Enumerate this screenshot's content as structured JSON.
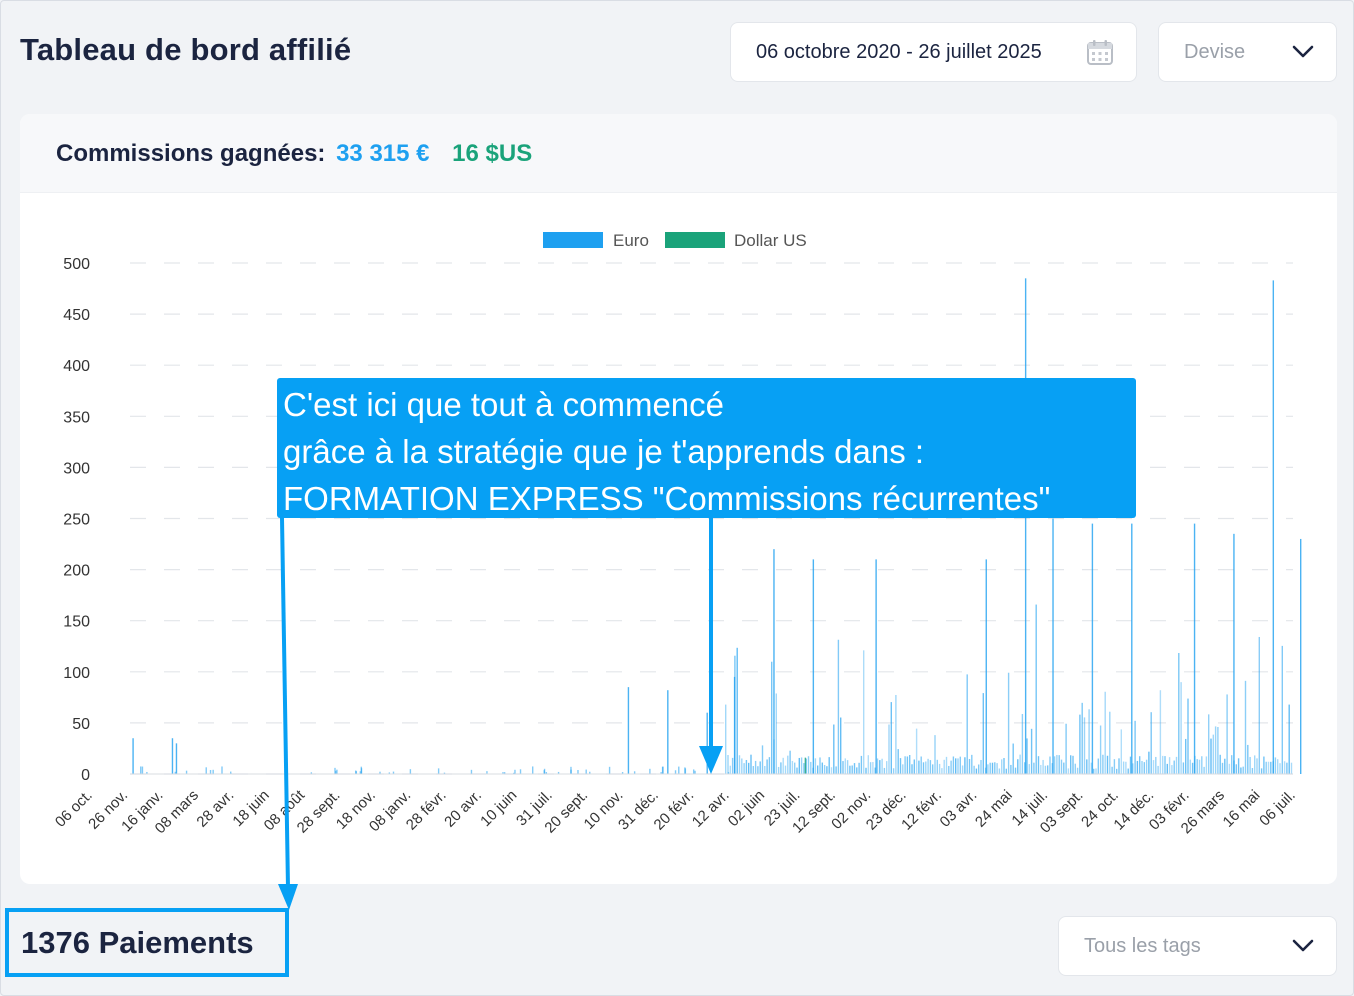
{
  "header": {
    "title": "Tableau de bord affilié",
    "date_range": "06 octobre 2020 - 26 juillet 2025",
    "currency_placeholder": "Devise"
  },
  "commissions": {
    "label": "Commissions gagnées:",
    "eur_total": "33 315 €",
    "usd_total": "16 $US"
  },
  "annotation": {
    "line1": "C'est ici que tout à commencé",
    "line2": "grâce à la stratégie que je t'apprends dans :",
    "line3": "FORMATION EXPRESS \"Commissions récurrentes\""
  },
  "footer": {
    "payments": "1376 Paiements",
    "tags_placeholder": "Tous les tags"
  },
  "colors": {
    "euro": "#1ea0f0",
    "usd": "#1aa37a",
    "annotation": "#07a0f4"
  },
  "chart_data": {
    "type": "bar",
    "legend": [
      "Euro",
      "Dollar US"
    ],
    "legend_position": "top-center",
    "grid": true,
    "ylim": [
      0,
      500
    ],
    "yticks": [
      0,
      50,
      100,
      150,
      200,
      250,
      300,
      350,
      400,
      450,
      500
    ],
    "xticks": [
      "06 oct.",
      "26 nov.",
      "16 janv.",
      "08 mars",
      "28 avr.",
      "18 juin",
      "08 août",
      "28 sept.",
      "18 nov.",
      "08 janv.",
      "28 févr.",
      "20 avr.",
      "10 juin",
      "31 juil.",
      "20 sept.",
      "10 nov.",
      "31 déc.",
      "20 févr.",
      "12 avr.",
      "02 juin",
      "23 juil.",
      "12 sept.",
      "02 nov.",
      "23 déc.",
      "12 févr.",
      "03 avr.",
      "24 mai",
      "14 juil.",
      "03 sept.",
      "24 oct.",
      "14 déc.",
      "03 févr.",
      "26 mars",
      "16 mai",
      "06 juil."
    ],
    "series": [
      {
        "name": "Euro",
        "peaks": [
          {
            "x": "26 nov.",
            "value": 35
          },
          {
            "x": "16 janv.",
            "value": 35
          },
          {
            "x": "16 janv.",
            "value": 30
          },
          {
            "x": "10 nov.",
            "value": 85
          },
          {
            "x": "31 déc.",
            "value": 82
          },
          {
            "x": "20 févr.",
            "value": 60
          },
          {
            "x": "12 avr.",
            "value": 95
          },
          {
            "x": "02 juin",
            "value": 220
          },
          {
            "x": "23 juil.",
            "value": 210
          },
          {
            "x": "02 nov.",
            "value": 210
          },
          {
            "x": "03 avr.",
            "value": 210
          },
          {
            "x": "24 mai",
            "value": 485
          },
          {
            "x": "14 juil.",
            "value": 250
          },
          {
            "x": "03 sept.",
            "value": 245
          },
          {
            "x": "24 oct.",
            "value": 245
          },
          {
            "x": "03 févr.",
            "value": 245
          },
          {
            "x": "26 mars",
            "value": 235
          },
          {
            "x": "16 mai",
            "value": 483
          },
          {
            "x": "06 juil.",
            "value": 230
          }
        ]
      },
      {
        "name": "Dollar US",
        "peaks": [
          {
            "x": "23 juil.",
            "value": 16
          }
        ]
      }
    ]
  }
}
